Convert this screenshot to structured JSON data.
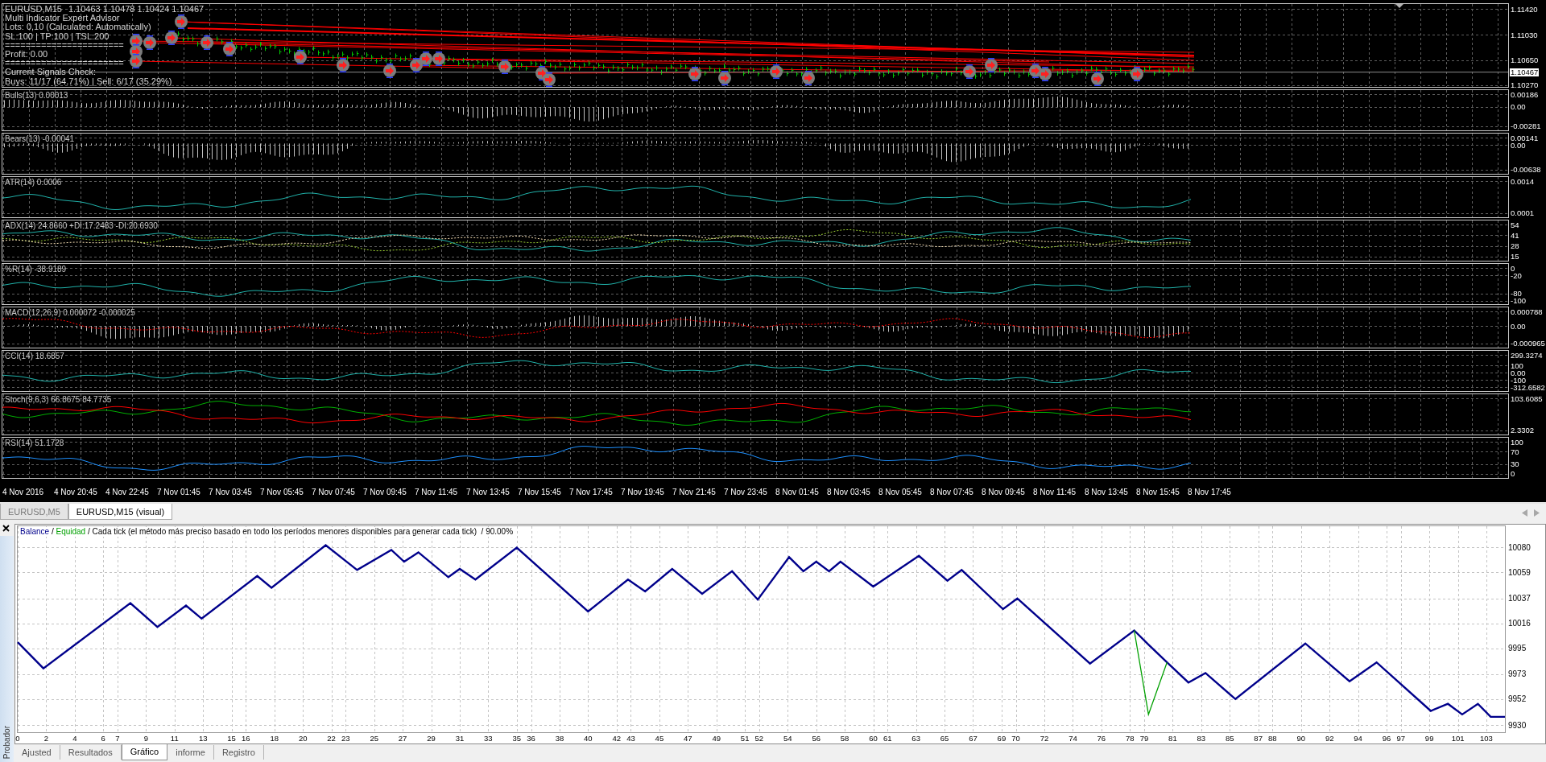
{
  "chart_window": {
    "symbol": "EURUSD,M15",
    "ohlc": "1.10463 1.10478 1.10424 1.10467",
    "comment_lines": [
      "Multi Indicator Expert Advisor",
      "Lots: 0,10 (Calculated: Automatically)",
      "SL:100 | TP:100 | TSL:200",
      "=======================",
      "Profit: 0.00",
      "=======================",
      "Current Signals Check:",
      "Buys: 11/17 (64.71%) | Sell: 6/17 (35.29%)"
    ],
    "price_axis": [
      "1.11420",
      "1.11030",
      "1.10650",
      "1.10270"
    ],
    "current_price": "1.10467",
    "indicators": [
      {
        "label": "Bulls(13) 0.00013",
        "axis": [
          "0.00186",
          "0.00",
          "-0.00281"
        ],
        "series": [
          {
            "kind": "histogram",
            "color": "#c0c0c0"
          }
        ]
      },
      {
        "label": "Bears(13) -0.00041",
        "axis": [
          "0.00141",
          "0.00",
          "-0.00638"
        ],
        "series": [
          {
            "kind": "histogram",
            "color": "#c0c0c0"
          }
        ]
      },
      {
        "label": "ATR(14) 0.0006",
        "axis": [
          "0.0014",
          "0.0001"
        ],
        "series": [
          {
            "kind": "line",
            "color": "#20b2aa"
          }
        ]
      },
      {
        "label": "ADX(14) 24.8660 +DI:17.2483 -DI:20.6930",
        "axis": [
          "54",
          "41",
          "28",
          "15"
        ],
        "series": [
          {
            "kind": "line",
            "color": "#20b2aa"
          },
          {
            "kind": "dotted",
            "color": "#9acd32"
          },
          {
            "kind": "dotted",
            "color": "#f5deb3"
          }
        ]
      },
      {
        "label": "%R(14) -38.9189",
        "axis": [
          "0",
          "-20",
          "-80",
          "-100"
        ],
        "series": [
          {
            "kind": "line",
            "color": "#20b2aa"
          }
        ]
      },
      {
        "label": "MACD(12,26,9) 0.000072 -0.000025",
        "axis": [
          "0.000788",
          "0.00",
          "-0.000965"
        ],
        "series": [
          {
            "kind": "histogram",
            "color": "#c0c0c0"
          },
          {
            "kind": "dotted",
            "color": "#ff0000"
          }
        ]
      },
      {
        "label": "CCI(14) 18.6857",
        "axis": [
          "299.3274",
          "100",
          "0.00",
          "-100",
          "-312.6582"
        ],
        "series": [
          {
            "kind": "line",
            "color": "#20b2aa"
          }
        ]
      },
      {
        "label": "Stoch(9,6,3) 66.8675 84.7735",
        "axis": [
          "103.6085",
          "2.3302"
        ],
        "series": [
          {
            "kind": "line",
            "color": "#00b000"
          },
          {
            "kind": "line",
            "color": "#ff0000"
          }
        ]
      },
      {
        "label": "RSI(14) 51.1728",
        "axis": [
          "100",
          "70",
          "30",
          "0"
        ],
        "series": [
          {
            "kind": "line",
            "color": "#1e90ff"
          }
        ]
      }
    ],
    "time_axis": [
      "4 Nov 2016",
      "4 Nov 20:45",
      "4 Nov 22:45",
      "7 Nov 01:45",
      "7 Nov 03:45",
      "7 Nov 05:45",
      "7 Nov 07:45",
      "7 Nov 09:45",
      "7 Nov 11:45",
      "7 Nov 13:45",
      "7 Nov 15:45",
      "7 Nov 17:45",
      "7 Nov 19:45",
      "7 Nov 21:45",
      "7 Nov 23:45",
      "8 Nov 01:45",
      "8 Nov 03:45",
      "8 Nov 05:45",
      "8 Nov 07:45",
      "8 Nov 09:45",
      "8 Nov 11:45",
      "8 Nov 13:45",
      "8 Nov 15:45",
      "8 Nov 17:45"
    ]
  },
  "chart_tabs": [
    {
      "label": "EURUSD,M5",
      "selected": false
    },
    {
      "label": "EURUSD,M15 (visual)",
      "selected": true
    }
  ],
  "tester": {
    "panel_title": "Probador",
    "chart": {
      "legend_separator": "/",
      "legend_text": "Cada tick (el método más preciso basado en todo los períodos menores disponibles para generar cada tick)",
      "quality": "90.00%",
      "chart_data": {
        "type": "line",
        "grid": true,
        "x": [
          0,
          1.8,
          7.9,
          9.8,
          11.8,
          12.9,
          16.8,
          17.8,
          21.6,
          23.8,
          26.2,
          27.1,
          28.1,
          30.2,
          31.0,
          32.1,
          35.0,
          40.0,
          42.8,
          44.0,
          45.9,
          48.0,
          50.1,
          51.9,
          54.1,
          55.1,
          56.0,
          56.9,
          57.7,
          60.0,
          63.2,
          65.2,
          66.2,
          69.1,
          70.1,
          75.2,
          78.3,
          79.3,
          80.6,
          82.1,
          83.3,
          85.4,
          90.3,
          93.4,
          95.3,
          99.1,
          100.3,
          101.3,
          102.4,
          103.3,
          104.3
        ],
        "series": [
          {
            "name": "Balance",
            "color": "#00008b",
            "values": [
              10000,
              9978,
              10033,
              10013,
              10031,
              10020,
              10056,
              10046,
              10082,
              10061,
              10078,
              10068,
              10076,
              10055,
              10062,
              10053,
              10080,
              10026,
              10053,
              10043,
              10062,
              10041,
              10060,
              10036,
              10072,
              10060,
              10068,
              10060,
              10068,
              10047,
              10073,
              10052,
              10061,
              10028,
              10037,
              9982,
              10010,
              9998,
              9983,
              9966,
              9974,
              9952,
              9999,
              9967,
              9983,
              9942,
              9948,
              9939,
              9948,
              9937,
              9937
            ]
          },
          {
            "name": "Equidad",
            "color": "#00a000",
            "values": [
              null,
              null,
              null,
              null,
              null,
              null,
              null,
              null,
              null,
              null,
              null,
              null,
              null,
              null,
              null,
              null,
              null,
              null,
              null,
              null,
              null,
              null,
              null,
              null,
              null,
              null,
              null,
              null,
              null,
              null,
              null,
              null,
              null,
              null,
              null,
              null,
              10010,
              9939,
              9983,
              null,
              null,
              null,
              null,
              null,
              null,
              null,
              null,
              null,
              null,
              null,
              null
            ]
          }
        ],
        "xlim": [
          0,
          104.3
        ],
        "ylim": [
          9924,
          10098
        ],
        "xticks": [
          0,
          2,
          4,
          6,
          7,
          9,
          11,
          13,
          15,
          16,
          18,
          20,
          22,
          23,
          25,
          27,
          29,
          31,
          33,
          35,
          36,
          38,
          40,
          42,
          43,
          45,
          47,
          49,
          51,
          52,
          54,
          56,
          58,
          60,
          61,
          63,
          65,
          67,
          69,
          70,
          72,
          74,
          76,
          78,
          79,
          81,
          83,
          85,
          87,
          88,
          90,
          92,
          94,
          96,
          97,
          99,
          101,
          103
        ],
        "yticks": [
          10080,
          10059,
          10037,
          10016,
          9995,
          9973,
          9952,
          9930
        ]
      }
    },
    "tabs": [
      {
        "label": "Ajusted",
        "selected": false
      },
      {
        "label": "Resultados",
        "selected": false
      },
      {
        "label": "Gráfico",
        "selected": true
      },
      {
        "label": "informe",
        "selected": false
      },
      {
        "label": "Registro",
        "selected": false
      }
    ]
  }
}
